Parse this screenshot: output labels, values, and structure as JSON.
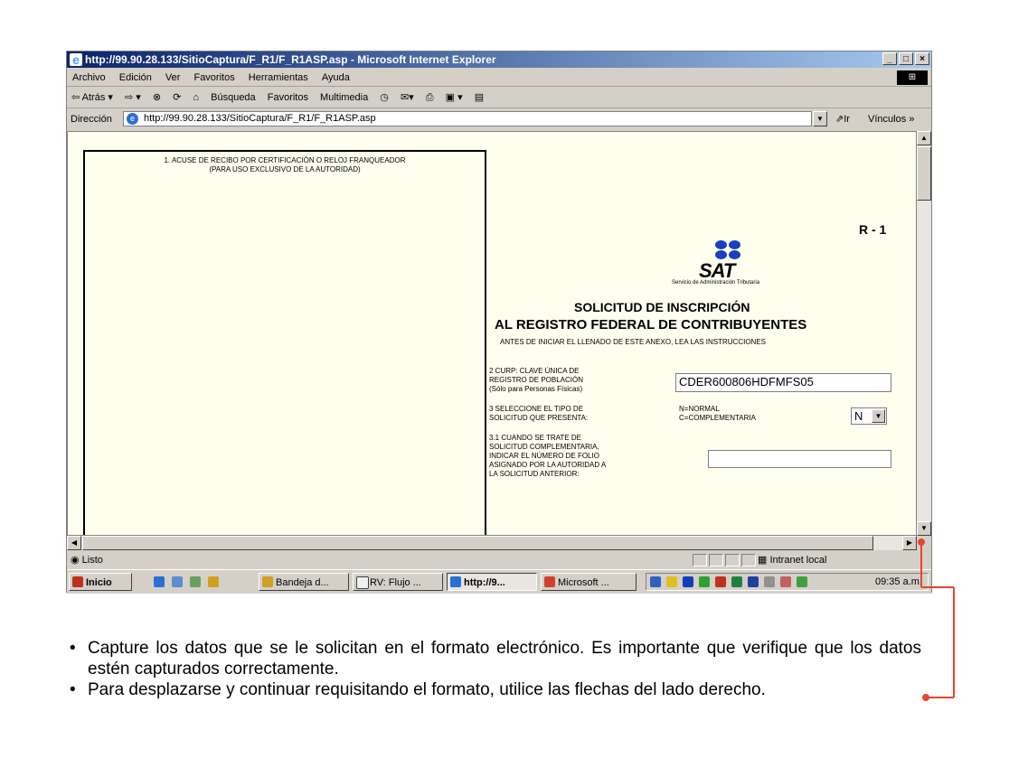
{
  "window": {
    "title": "http://99.90.28.133/SitioCaptura/F_R1/F_R1ASP.asp - Microsoft Internet Explorer",
    "controls": [
      "_",
      "□",
      "×"
    ]
  },
  "menu": [
    "Archivo",
    "Edición",
    "Ver",
    "Favoritos",
    "Herramientas",
    "Ayuda"
  ],
  "toolbar": {
    "back": "⇦ Atrás ▾",
    "forward": "⇨ ▾",
    "stop": "⊗",
    "refresh": "⟳",
    "home": "⌂",
    "search": "Búsqueda",
    "favorites": "Favoritos",
    "multimedia": "Multimedia",
    "history": "◷",
    "mail": "✉▾",
    "print": "⎙",
    "edit": "▣ ▾",
    "discuss": "▤"
  },
  "address": {
    "label": "Dirección",
    "url": "http://99.90.28.133/SitioCaptura/F_R1/F_R1ASP.asp",
    "go": "Ir",
    "links": "Vínculos »"
  },
  "form": {
    "box1_title_1": "1. ACUSE DE RECIBO POR CERTIFICACIÓN O RELOJ FRANQUEADOR",
    "box1_title_2": "(PARA USO EXCLUSIVO DE LA AUTORIDAD)",
    "code": "R - 1",
    "logo_text": "SAT",
    "logo_sub": "Servicio de Administración Tributaria",
    "title_1": "SOLICITUD DE INSCRIPCIÓN",
    "title_2": "AL REGISTRO FEDERAL DE CONTRIBUYENTES",
    "title_3": "ANTES DE INICIAR EL LLENADO DE ESTE ANEXO, LEA LAS INSTRUCCIONES",
    "curp_label_1": "2  CURP: CLAVE ÚNICA DE",
    "curp_label_2": "REGISTRO DE POBLACIÓN",
    "curp_label_3": "(Sólo para Personas Físicas)",
    "curp_value": "CDER600806HDFMFS05",
    "tipo_label_1": "3  SELECCIONE EL TIPO DE",
    "tipo_label_2": "SOLICITUD QUE PRESENTA:",
    "tipo_opt_1": "N=NORMAL",
    "tipo_opt_2": "C=COMPLEMENTARIA",
    "tipo_value": "N",
    "folio_label_1": "3.1   CUANDO SE TRATE DE",
    "folio_label_2": "SOLICITUD COMPLEMENTARIA,",
    "folio_label_3": "INDICAR EL NÚMERO DE FOLIO",
    "folio_label_4": "ASIGNADO POR LA AUTORIDAD A",
    "folio_label_5": "LA SOLICITUD ANTERIOR:",
    "folio_value": ""
  },
  "status": {
    "left": "Listo",
    "zone": "Intranet local"
  },
  "taskbar": {
    "start": "Inicio",
    "items": [
      "Bandeja d...",
      "RV: Flujo ...",
      "http://9...",
      "Microsoft ..."
    ],
    "clock": "09:35 a.m."
  },
  "instructions": [
    "Capture los datos que se le solicitan en el formato electrónico. Es importante que verifique que los datos estén capturados correctamente.",
    "Para desplazarse y continuar requisitando el formato, utilice las flechas del lado derecho."
  ],
  "colors": {
    "callout": "#e8452c",
    "page_bg": "#fffff0"
  }
}
